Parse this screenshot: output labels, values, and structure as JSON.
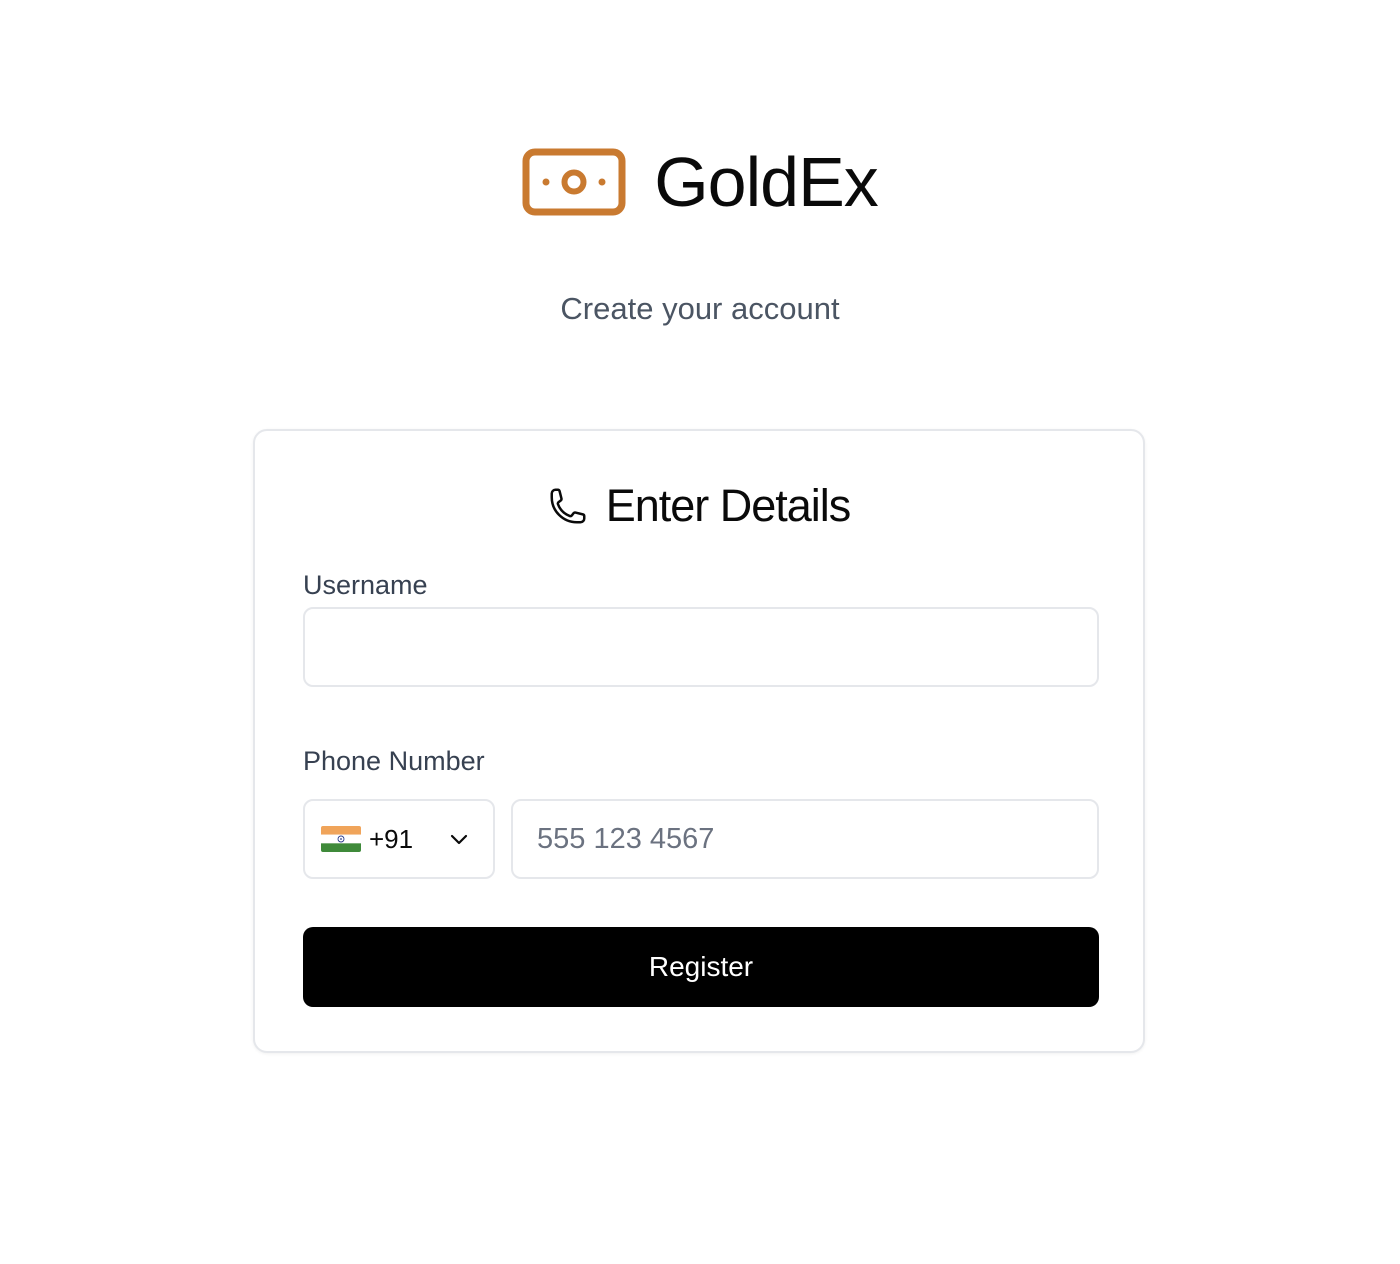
{
  "brand": {
    "name": "GoldEx",
    "icon": "banknote-icon",
    "accent_color": "#c97a30"
  },
  "subtitle": "Create your account",
  "card": {
    "title": "Enter Details",
    "title_icon": "phone-icon",
    "username": {
      "label": "Username",
      "value": "",
      "placeholder": ""
    },
    "phone": {
      "label": "Phone Number",
      "country": {
        "flag": "india-flag-icon",
        "dial_code": "+91"
      },
      "value": "",
      "placeholder": "555 123 4567"
    },
    "register_label": "Register"
  }
}
